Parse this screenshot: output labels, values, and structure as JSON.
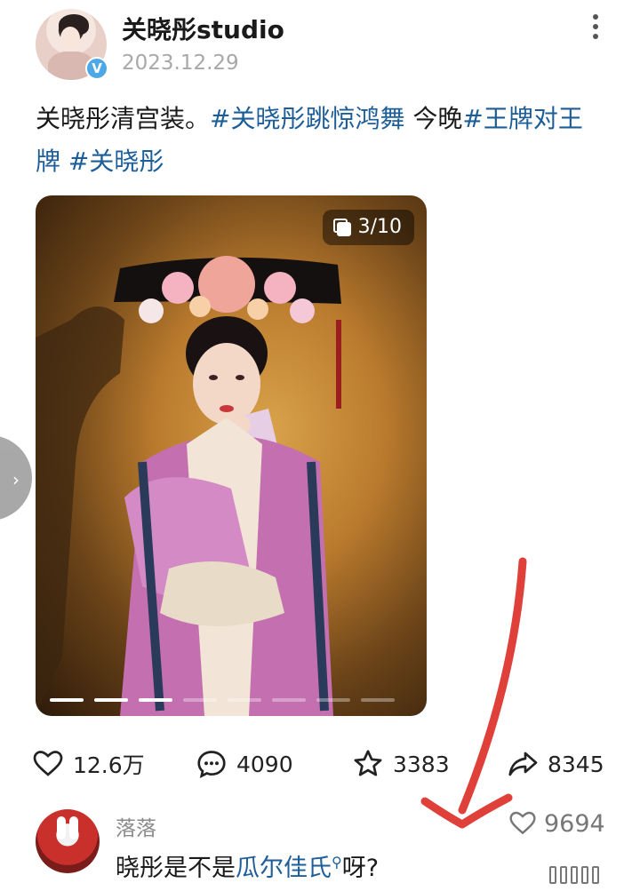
{
  "author": {
    "username": "关晓彤studio",
    "date": "2023.12.29"
  },
  "post": {
    "text_plain": "关晓彤清宫装。",
    "tag1": "#关晓彤跳惊鸿舞",
    "text_mid": " 今晚",
    "tag2": "#王牌对王牌",
    "tag3": " #关晓彤"
  },
  "photo": {
    "counter": "3/10",
    "current_index": 3,
    "total": 10
  },
  "stats": {
    "likes": "12.6万",
    "comments": "4090",
    "favorites": "3383",
    "shares": "8345"
  },
  "comment": {
    "name": "落落",
    "text_before": "晓彤是不是",
    "link": "瓜尔佳氏",
    "text_after": "呀?",
    "likes": "9694"
  },
  "colors": {
    "link": "#1d5e99",
    "arrow": "#e0403a",
    "verified": "#4ea8e8"
  }
}
